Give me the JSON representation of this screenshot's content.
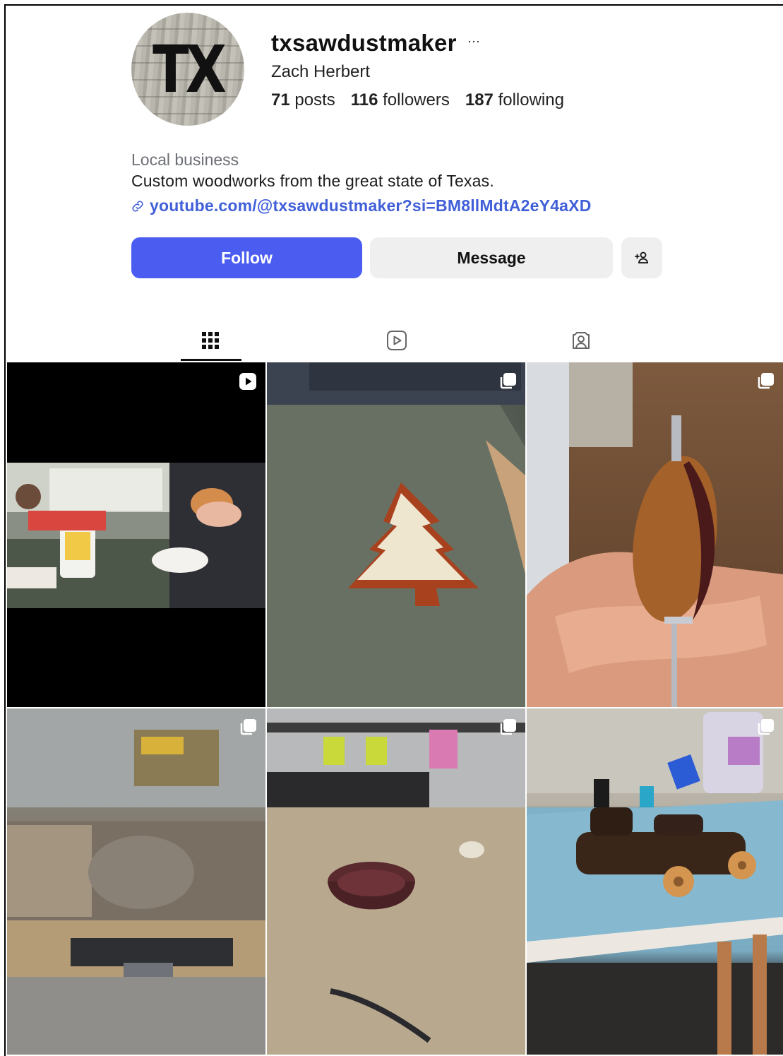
{
  "profile": {
    "avatar_text": "TX",
    "username": "txsawdustmaker",
    "more": "···",
    "full_name": "Zach Herbert",
    "stats": {
      "posts_count": "71",
      "posts_label": "posts",
      "followers_count": "116",
      "followers_label": "followers",
      "following_count": "187",
      "following_label": "following"
    },
    "category": "Local business",
    "bio": "Custom woodworks from the great state of Texas.",
    "link": "youtube.com/@txsawdustmaker?si=BM8llMdtA2eY4aXD"
  },
  "actions": {
    "follow_label": "Follow",
    "message_label": "Message",
    "add_user_icon": "add-person-icon"
  },
  "tabs": [
    {
      "icon": "grid-icon",
      "active": true
    },
    {
      "icon": "reels-icon",
      "active": false
    },
    {
      "icon": "tagged-icon",
      "active": false
    }
  ],
  "posts": [
    {
      "type": "reel",
      "badge": "reel-icon"
    },
    {
      "type": "carousel",
      "badge": "carousel-icon"
    },
    {
      "type": "carousel",
      "badge": "carousel-icon"
    },
    {
      "type": "carousel",
      "badge": "carousel-icon"
    },
    {
      "type": "carousel",
      "badge": "carousel-icon"
    },
    {
      "type": "carousel",
      "badge": "carousel-icon"
    }
  ],
  "colors": {
    "follow_button": "#4a5df0",
    "secondary_button": "#efefef",
    "link": "#4160d8",
    "category_text": "#6c6f75"
  }
}
